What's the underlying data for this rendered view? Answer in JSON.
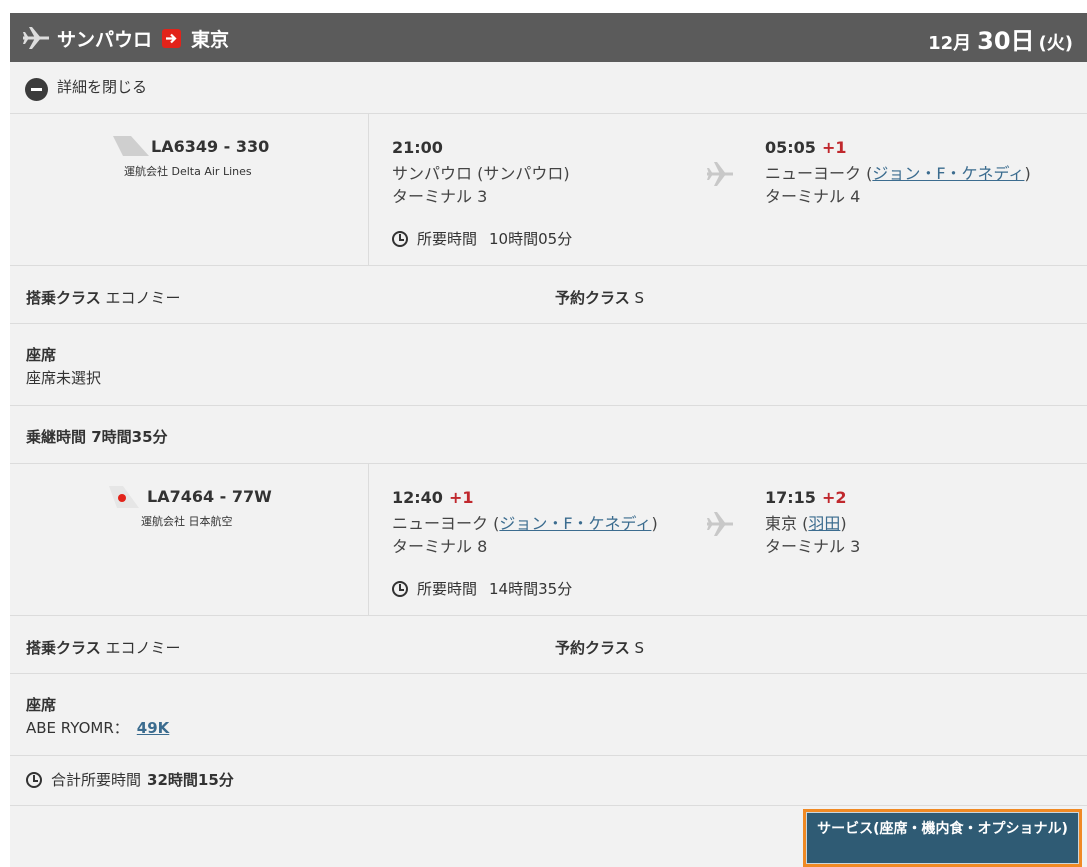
{
  "header": {
    "origin": "サンパウロ",
    "destination": "東京",
    "month": "12月",
    "day": "30日",
    "weekday": "(火)"
  },
  "close_details": "詳細を閉じる",
  "segments": [
    {
      "flight_number": "LA6349 - 330",
      "operator": "運航会社 Delta Air Lines",
      "dep_time": "21:00",
      "dep_plus": "",
      "dep_city": "サンパウロ (サンパウロ)",
      "dep_city_prefix": "",
      "dep_airport_link": "",
      "dep_terminal": "ターミナル 3",
      "arr_time": "05:05",
      "arr_plus": "+1",
      "arr_city_prefix": "ニューヨーク (",
      "arr_airport_link": "ジョン・F・ケネディ",
      "arr_city_suffix": ")",
      "arr_terminal": "ターミナル 4",
      "duration_label": "所要時間",
      "duration": "10時間05分",
      "class_label": "搭乗クラス",
      "class_value": "エコノミー",
      "booking_label": "予約クラス",
      "booking_value": "S",
      "seat_label": "座席",
      "seat_value": "座席未選択"
    },
    {
      "flight_number": "LA7464 - 77W",
      "operator": "運航会社 日本航空",
      "dep_time": "12:40",
      "dep_plus": "+1",
      "dep_city_prefix": "ニューヨーク (",
      "dep_airport_link": "ジョン・F・ケネディ",
      "dep_city_suffix": ")",
      "dep_terminal": "ターミナル 8",
      "arr_time": "17:15",
      "arr_plus": "+2",
      "arr_city_prefix": "東京 (",
      "arr_airport_link": "羽田",
      "arr_city_suffix": ")",
      "arr_terminal": "ターミナル 3",
      "duration_label": "所要時間",
      "duration": "14時間35分",
      "class_label": "搭乗クラス",
      "class_value": "エコノミー",
      "booking_label": "予約クラス",
      "booking_value": "S",
      "seat_label": "座席",
      "seat_passenger": "ABE RYOMR：",
      "seat_number": "49K"
    }
  ],
  "transfer": "乗継時間 7時間35分",
  "total": {
    "label": "合計所要時間",
    "value": "32時間15分"
  },
  "service_button": "サービス(座席・機内食・オプショナル)",
  "colors": {
    "header_bg": "#5b5b5b",
    "accent_red": "#e2231a",
    "link": "#3b6c8f",
    "button_bg": "#2f5b74",
    "button_border": "#f08a24"
  }
}
